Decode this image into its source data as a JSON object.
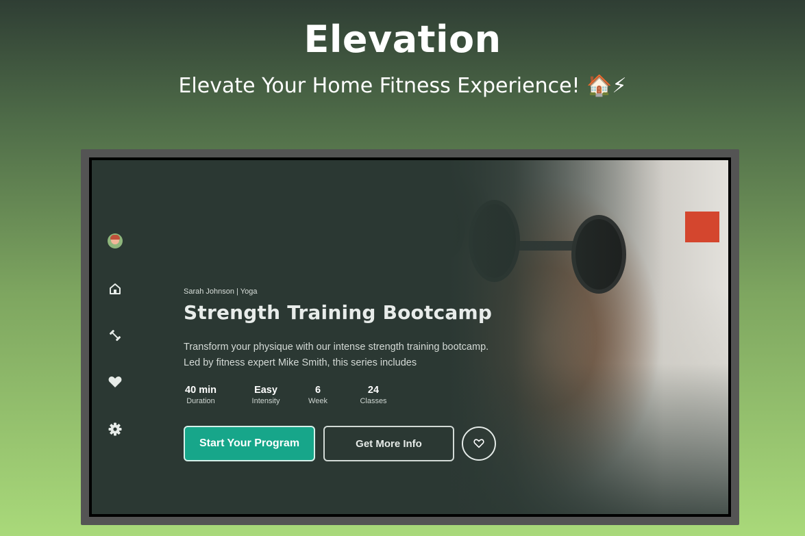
{
  "header": {
    "title": "Elevation",
    "tagline": "Elevate Your Home Fitness Experience! 🏠⚡"
  },
  "sidebar": {
    "items": [
      {
        "name": "avatar",
        "icon": "user-avatar-icon"
      },
      {
        "name": "home",
        "icon": "home-icon"
      },
      {
        "name": "workouts",
        "icon": "dumbbell-icon"
      },
      {
        "name": "favorites",
        "icon": "heart-icon"
      },
      {
        "name": "settings",
        "icon": "gear-icon"
      }
    ]
  },
  "program": {
    "meta": "Sarah Johnson | Yoga",
    "title": "Strength Training Bootcamp",
    "description": "Transform your physique with our intense strength training bootcamp. Led by fitness expert Mike Smith, this series includes",
    "stats": [
      {
        "value": "40 min",
        "label": "Duration"
      },
      {
        "value": "Easy",
        "label": "Intensity"
      },
      {
        "value": "6",
        "label": "Week"
      },
      {
        "value": "24",
        "label": "Classes"
      }
    ]
  },
  "actions": {
    "start_label": "Start Your Program",
    "info_label": "Get More Info",
    "favorite_icon": "heart-outline-icon"
  },
  "colors": {
    "accent": "#17a68a",
    "screen_bg": "#2b3833"
  }
}
